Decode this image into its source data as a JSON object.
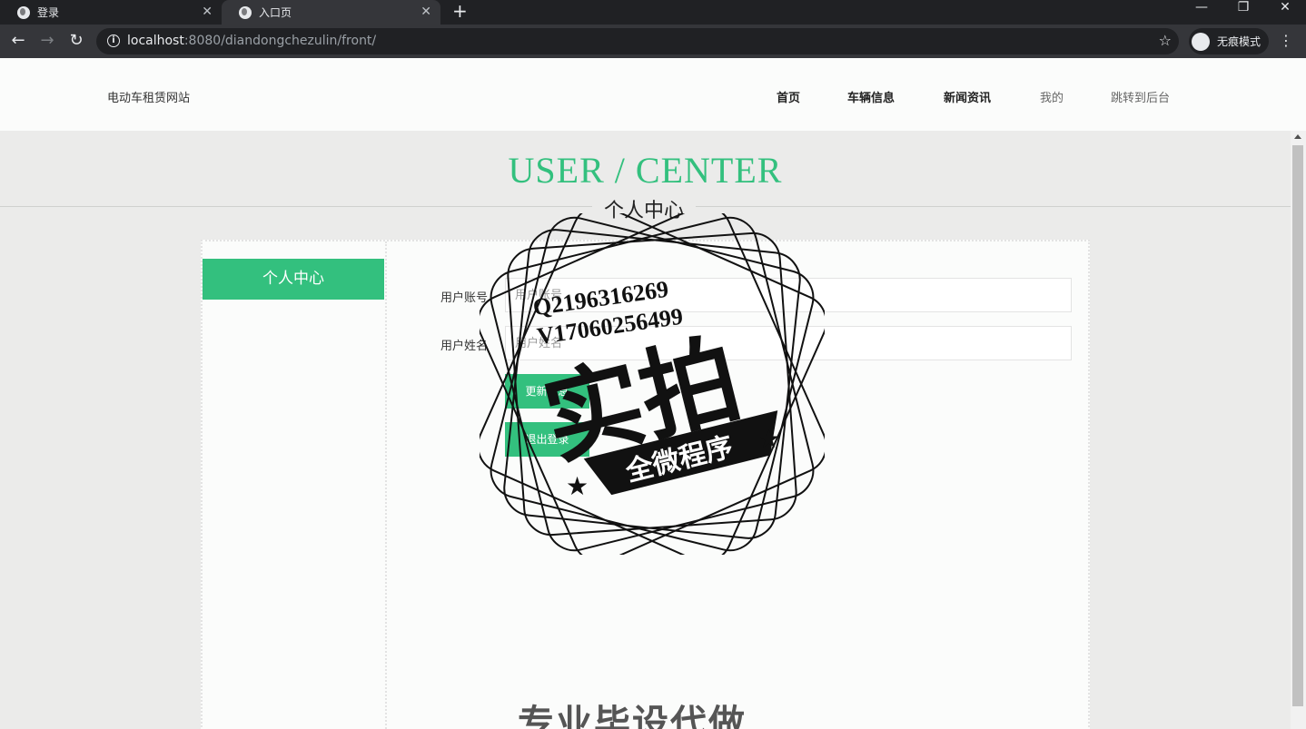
{
  "browser": {
    "tabs": [
      {
        "title": "登录"
      },
      {
        "title": "入口页"
      }
    ],
    "new_tab": "+",
    "close_glyph": "✕",
    "url_host": "localhost",
    "url_rest": ":8080/diandongchezulin/front/",
    "incognito_label": "无痕模式"
  },
  "header": {
    "site_title": "电动车租赁网站",
    "nav": [
      "首页",
      "车辆信息",
      "新闻资讯",
      "我的",
      "跳转到后台"
    ]
  },
  "hero": {
    "title_en": "USER / CENTER",
    "title_cn": "个人中心"
  },
  "sidebar": {
    "items": [
      {
        "label": "个人中心"
      }
    ]
  },
  "form": {
    "account_label": "用户账号",
    "account_placeholder": "用户账号",
    "name_label": "用户姓名",
    "name_placeholder": "用户姓名",
    "update_button": "更新信息",
    "logout_button": "退出登录"
  },
  "watermark": {
    "qq": "Q2196316269",
    "v": "V17060256499",
    "main": "实拍",
    "ribbon": "全微程序",
    "bottom": "专业毕设代做"
  },
  "colors": {
    "accent": "#33c07e",
    "page_bg": "#ebebea"
  }
}
